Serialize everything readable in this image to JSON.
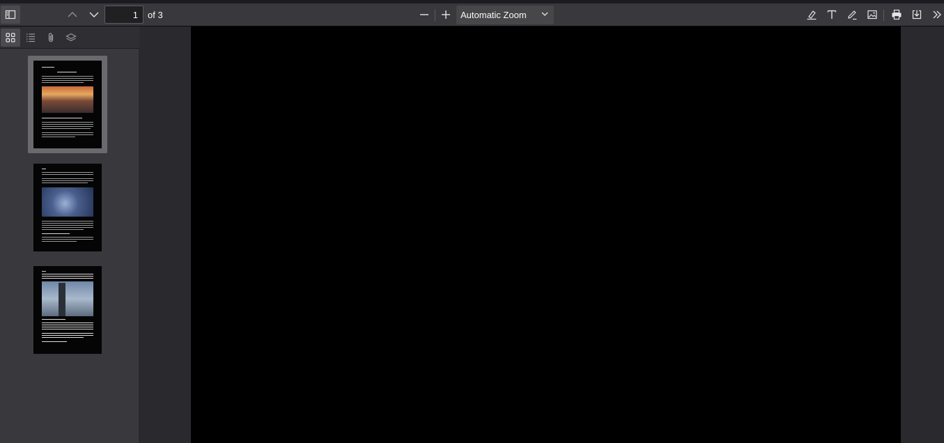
{
  "toolbar": {
    "page_number": "1",
    "page_count_label": "of 3",
    "zoom_label": "Automatic Zoom"
  },
  "icons": {
    "sidebar_toggle": "sidebar-toggle-icon",
    "prev": "chevron-up-icon",
    "next": "chevron-down-icon",
    "zoom_out": "minus-icon",
    "zoom_in": "plus-icon",
    "highlight": "highlighter-icon",
    "text": "text-icon",
    "draw": "pen-icon",
    "image": "image-icon",
    "print": "printer-icon",
    "save": "download-icon",
    "more": "double-chevron-right-icon"
  },
  "sidebar": {
    "tabs": [
      "thumbnails",
      "outline",
      "attachments",
      "layers"
    ]
  },
  "colors": {
    "toolbar_bg": "#38383d",
    "viewer_bg": "#2a2a2e",
    "page_bg": "#000000"
  }
}
